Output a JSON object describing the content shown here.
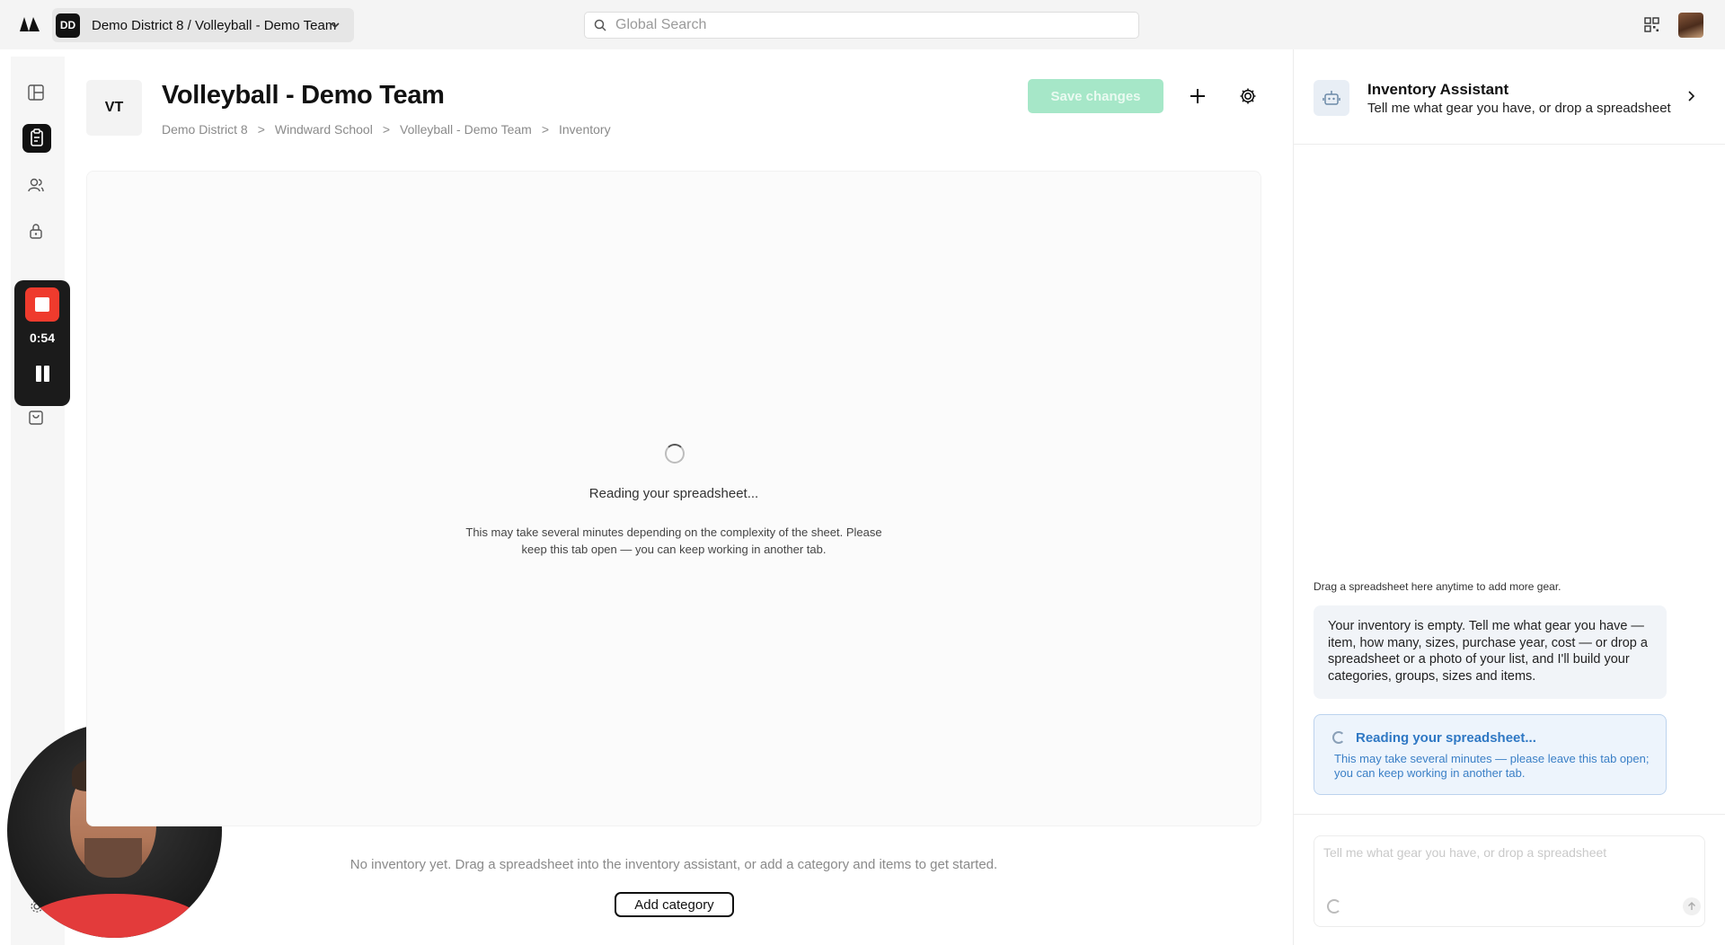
{
  "topbar": {
    "team_initials": "DD",
    "team_label": "Demo District 8 / Volleyball - Demo Team",
    "search_placeholder": "Global Search"
  },
  "recorder": {
    "time": "0:54"
  },
  "header": {
    "badge": "VT",
    "title": "Volleyball - Demo Team",
    "breadcrumb": [
      "Demo District 8",
      "Windward School",
      "Volleyball - Demo Team",
      "Inventory"
    ],
    "separator": ">",
    "save_label": "Save changes"
  },
  "main": {
    "loading_title": "Reading your spreadsheet...",
    "loading_sub": "This may take several minutes depending on the complexity of the sheet. Please keep this tab open — you can keep working in another tab.",
    "empty_note": "No inventory yet. Drag a spreadsheet into the inventory assistant, or add a category and items to get started.",
    "add_category_label": "Add category"
  },
  "assistant": {
    "title": "Inventory Assistant",
    "subtitle": "Tell me what gear you have, or drop a spreadsheet",
    "drag_note": "Drag a spreadsheet here anytime to add more gear.",
    "message": "Your inventory is empty. Tell me what gear you have — item, how many, sizes, purchase year, cost — or drop a spreadsheet or a photo of your list, and I'll build your categories, groups, sizes and items.",
    "status_title": "Reading your spreadsheet...",
    "status_sub": "This may take several minutes — please leave this tab open; you can keep working in another tab.",
    "composer_placeholder": "Tell me what gear you have, or drop a spreadsheet"
  },
  "colors": {
    "accent_green": "#a6e7c8",
    "status_blue": "#2f78c4",
    "record_red": "#ef3b2d"
  }
}
